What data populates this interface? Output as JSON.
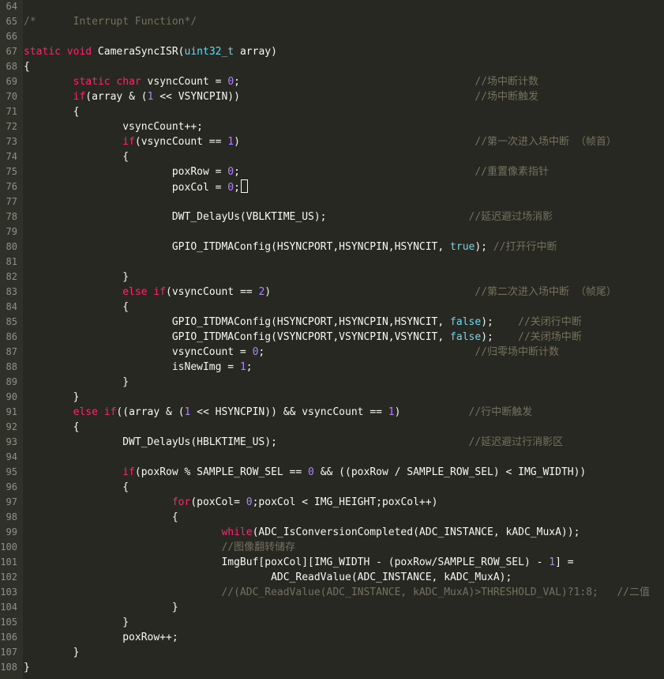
{
  "editor": {
    "lines": [
      {
        "n": "64",
        "tokens": []
      },
      {
        "n": "65",
        "tokens": [
          {
            "t": "/*      Interrupt Function*/",
            "c": "cm"
          }
        ]
      },
      {
        "n": "66",
        "tokens": []
      },
      {
        "n": "67",
        "tokens": [
          {
            "t": "static",
            "c": "kw"
          },
          {
            "t": " "
          },
          {
            "t": "void",
            "c": "kw"
          },
          {
            "t": " CameraSyncISR("
          },
          {
            "t": "uint32_t",
            "c": "type"
          },
          {
            "t": " array)"
          }
        ]
      },
      {
        "n": "68",
        "tokens": [
          {
            "t": "{"
          }
        ]
      },
      {
        "n": "69",
        "tokens": [
          {
            "t": "        "
          },
          {
            "t": "static",
            "c": "kw"
          },
          {
            "t": " "
          },
          {
            "t": "char",
            "c": "kw"
          },
          {
            "t": " vsyncCount = "
          },
          {
            "t": "0",
            "c": "num"
          },
          {
            "t": ";                                      "
          },
          {
            "t": "//场中断计数",
            "c": "cm"
          }
        ]
      },
      {
        "n": "70",
        "tokens": [
          {
            "t": "        "
          },
          {
            "t": "if",
            "c": "kw"
          },
          {
            "t": "(array & ("
          },
          {
            "t": "1",
            "c": "num"
          },
          {
            "t": " << VSYNCPIN))                                      "
          },
          {
            "t": "//场中断触发",
            "c": "cm"
          }
        ]
      },
      {
        "n": "71",
        "tokens": [
          {
            "t": "        {"
          }
        ]
      },
      {
        "n": "72",
        "tokens": [
          {
            "t": "                vsyncCount++;"
          }
        ]
      },
      {
        "n": "73",
        "tokens": [
          {
            "t": "                "
          },
          {
            "t": "if",
            "c": "kw"
          },
          {
            "t": "(vsyncCount == "
          },
          {
            "t": "1",
            "c": "num"
          },
          {
            "t": ")                                      "
          },
          {
            "t": "//第一次进入场中断 （帧首）",
            "c": "cm"
          }
        ]
      },
      {
        "n": "74",
        "tokens": [
          {
            "t": "                {"
          }
        ]
      },
      {
        "n": "75",
        "tokens": [
          {
            "t": "                        poxRow = "
          },
          {
            "t": "0",
            "c": "num"
          },
          {
            "t": ";                                      "
          },
          {
            "t": "//重置像素指针",
            "c": "cm"
          }
        ]
      },
      {
        "n": "76",
        "tokens": [
          {
            "t": "                        poxCol = "
          },
          {
            "t": "0",
            "c": "num"
          },
          {
            "t": ";"
          }
        ],
        "caret": true
      },
      {
        "n": "77",
        "tokens": []
      },
      {
        "n": "78",
        "tokens": [
          {
            "t": "                        DWT_DelayUs(VBLKTIME_US);                       "
          },
          {
            "t": "//延迟避过场消影",
            "c": "cm"
          }
        ]
      },
      {
        "n": "79",
        "tokens": []
      },
      {
        "n": "80",
        "tokens": [
          {
            "t": "                        GPIO_ITDMAConfig(HSYNCPORT,HSYNCPIN,HSYNCIT, "
          },
          {
            "t": "true",
            "c": "lit"
          },
          {
            "t": "); "
          },
          {
            "t": "//打开行中断",
            "c": "cm"
          }
        ]
      },
      {
        "n": "81",
        "tokens": []
      },
      {
        "n": "82",
        "tokens": [
          {
            "t": "                }"
          }
        ]
      },
      {
        "n": "83",
        "tokens": [
          {
            "t": "                "
          },
          {
            "t": "else",
            "c": "kw"
          },
          {
            "t": " "
          },
          {
            "t": "if",
            "c": "kw"
          },
          {
            "t": "(vsyncCount == "
          },
          {
            "t": "2",
            "c": "num"
          },
          {
            "t": ")                                 "
          },
          {
            "t": "//第二次进入场中断 （帧尾）",
            "c": "cm"
          }
        ]
      },
      {
        "n": "84",
        "tokens": [
          {
            "t": "                {"
          }
        ]
      },
      {
        "n": "85",
        "tokens": [
          {
            "t": "                        GPIO_ITDMAConfig(HSYNCPORT,HSYNCPIN,HSYNCIT, "
          },
          {
            "t": "false",
            "c": "lit"
          },
          {
            "t": ");    "
          },
          {
            "t": "//关闭行中断",
            "c": "cm"
          }
        ]
      },
      {
        "n": "86",
        "tokens": [
          {
            "t": "                        GPIO_ITDMAConfig(VSYNCPORT,VSYNCPIN,VSYNCIT, "
          },
          {
            "t": "false",
            "c": "lit"
          },
          {
            "t": ");    "
          },
          {
            "t": "//关闭场中断",
            "c": "cm"
          }
        ]
      },
      {
        "n": "87",
        "tokens": [
          {
            "t": "                        vsyncCount = "
          },
          {
            "t": "0",
            "c": "num"
          },
          {
            "t": ";                                  "
          },
          {
            "t": "//归零场中断计数",
            "c": "cm"
          }
        ]
      },
      {
        "n": "88",
        "tokens": [
          {
            "t": "                        isNewImg = "
          },
          {
            "t": "1",
            "c": "num"
          },
          {
            "t": ";"
          }
        ]
      },
      {
        "n": "89",
        "tokens": [
          {
            "t": "                }"
          }
        ]
      },
      {
        "n": "90",
        "tokens": [
          {
            "t": "        }"
          }
        ]
      },
      {
        "n": "91",
        "tokens": [
          {
            "t": "        "
          },
          {
            "t": "else",
            "c": "kw"
          },
          {
            "t": " "
          },
          {
            "t": "if",
            "c": "kw"
          },
          {
            "t": "((array & ("
          },
          {
            "t": "1",
            "c": "num"
          },
          {
            "t": " << HSYNCPIN)) && vsyncCount == "
          },
          {
            "t": "1",
            "c": "num"
          },
          {
            "t": ")           "
          },
          {
            "t": "//行中断触发",
            "c": "cm"
          }
        ]
      },
      {
        "n": "92",
        "tokens": [
          {
            "t": "        {"
          }
        ]
      },
      {
        "n": "93",
        "tokens": [
          {
            "t": "                DWT_DelayUs(HBLKTIME_US);                               "
          },
          {
            "t": "//延迟避过行消影区",
            "c": "cm"
          }
        ]
      },
      {
        "n": "94",
        "tokens": []
      },
      {
        "n": "95",
        "tokens": [
          {
            "t": "                "
          },
          {
            "t": "if",
            "c": "kw"
          },
          {
            "t": "(poxRow % SAMPLE_ROW_SEL == "
          },
          {
            "t": "0",
            "c": "num"
          },
          {
            "t": " && ((poxRow / SAMPLE_ROW_SEL) < IMG_WIDTH))"
          }
        ]
      },
      {
        "n": "96",
        "tokens": [
          {
            "t": "                {"
          }
        ]
      },
      {
        "n": "97",
        "tokens": [
          {
            "t": "                        "
          },
          {
            "t": "for",
            "c": "kw"
          },
          {
            "t": "(poxCol= "
          },
          {
            "t": "0",
            "c": "num"
          },
          {
            "t": ";poxCol < IMG_HEIGHT;poxCol++)"
          }
        ]
      },
      {
        "n": "98",
        "tokens": [
          {
            "t": "                        {"
          }
        ]
      },
      {
        "n": "99",
        "tokens": [
          {
            "t": "                                "
          },
          {
            "t": "while",
            "c": "kw"
          },
          {
            "t": "(ADC_IsConversionCompleted(ADC_INSTANCE, kADC_MuxA));"
          }
        ]
      },
      {
        "n": "100",
        "tokens": [
          {
            "t": "                                "
          },
          {
            "t": "//图像翻转储存",
            "c": "cm"
          }
        ]
      },
      {
        "n": "101",
        "tokens": [
          {
            "t": "                                ImgBuf[poxCol][IMG_WIDTH - (poxRow/SAMPLE_ROW_SEL) - "
          },
          {
            "t": "1",
            "c": "num"
          },
          {
            "t": "] ="
          }
        ]
      },
      {
        "n": "102",
        "tokens": [
          {
            "t": "                                        ADC_ReadValue(ADC_INSTANCE, kADC_MuxA);"
          }
        ]
      },
      {
        "n": "103",
        "tokens": [
          {
            "t": "                                "
          },
          {
            "t": "//(ADC_ReadValue(ADC_INSTANCE, kADC_MuxA)>THRESHOLD_VAL)?1:8;   //二值",
            "c": "cm"
          }
        ]
      },
      {
        "n": "104",
        "tokens": [
          {
            "t": "                        }"
          }
        ]
      },
      {
        "n": "105",
        "tokens": [
          {
            "t": "                }"
          }
        ]
      },
      {
        "n": "106",
        "tokens": [
          {
            "t": "                poxRow++;"
          }
        ]
      },
      {
        "n": "107",
        "tokens": [
          {
            "t": "        }"
          }
        ]
      },
      {
        "n": "108",
        "tokens": [
          {
            "t": "}"
          }
        ]
      }
    ]
  }
}
